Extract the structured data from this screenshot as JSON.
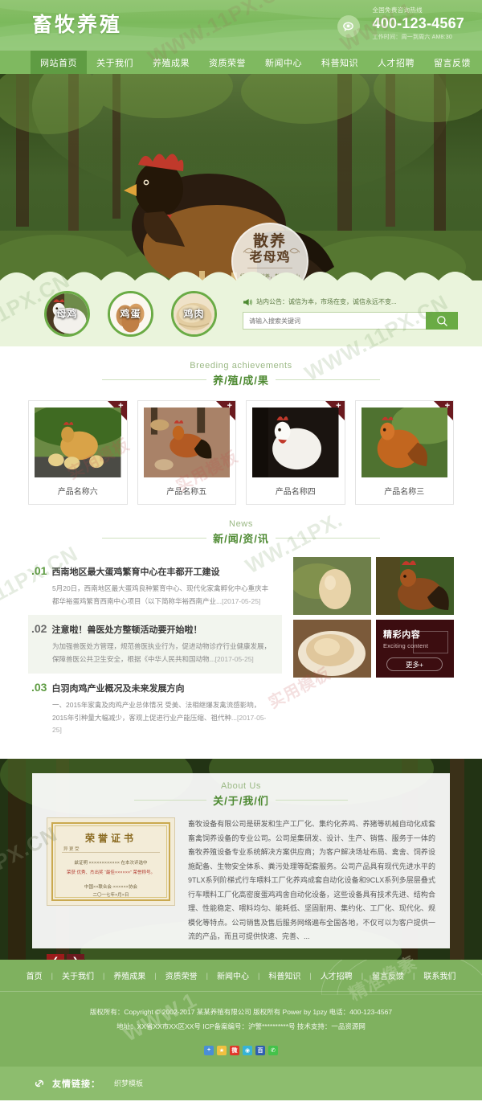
{
  "site": {
    "logo": "畜牧养殖",
    "tel_label": "全国免费咨询热线",
    "tel_number": "400-123-4567",
    "tel_time": "工作时间：周一到周六 AM8:30"
  },
  "nav": [
    {
      "label": "网站首页",
      "active": true
    },
    {
      "label": "关于我们",
      "active": false
    },
    {
      "label": "养殖成果",
      "active": false
    },
    {
      "label": "资质荣誉",
      "active": false
    },
    {
      "label": "新闻中心",
      "active": false
    },
    {
      "label": "科普知识",
      "active": false
    },
    {
      "label": "人才招聘",
      "active": false
    },
    {
      "label": "留言反馈",
      "active": false
    },
    {
      "label": "联系我们",
      "active": false
    }
  ],
  "banner": {
    "badge_line1": "散养",
    "badge_line2": "老母鸡",
    "badge_sub": "绿色食自然养，散养于青山绿林之中"
  },
  "features": [
    {
      "label": "母鸡"
    },
    {
      "label": "鸡蛋"
    },
    {
      "label": "鸡肉"
    }
  ],
  "search": {
    "notice": "站内公告：诚信为本，市场在变，诚信永远不变...",
    "placeholder": "请输入搜索关键词",
    "button_icon": "search-icon"
  },
  "achievements": {
    "heading_en": "Breeding achievements",
    "heading_cn": "养/殖/成/果",
    "corner_mark": "+",
    "items": [
      {
        "name": "产品名称六"
      },
      {
        "name": "产品名称五"
      },
      {
        "name": "产品名称四"
      },
      {
        "name": "产品名称三"
      }
    ]
  },
  "news": {
    "heading_en": "News",
    "heading_cn": "新/闻/资/讯",
    "items": [
      {
        "no": ".01",
        "title": "西南地区最大蛋鸡繁育中心在丰都开工建设",
        "desc": "5月20日，西南地区最大蛋鸡良种繁育中心、现代化家禽孵化中心重庆丰都华裕蛋鸡繁育西南中心项目（以下简称华裕西南产业...",
        "date": "[2017-05-25]"
      },
      {
        "no": ".02",
        "title": "注意啦！兽医处方整顿活动要开始啦！",
        "desc": "为加强兽医处方管理，规范兽医执业行为，促进动物诊疗行业健康发展，保障兽医公共卫生安全，根据《中华人民共和国动物...",
        "date": "[2017-05-25]"
      },
      {
        "no": ".03",
        "title": "白羽肉鸡产业概况及未来发展方向",
        "desc": "一、2015年家禽及肉鸡产业总体情况 受美、法相继爆发禽流感影响，2015年引种量大幅减少，客观上促进行业产能压缩、祖代种...",
        "date": "[2017-05-25]"
      }
    ],
    "promo": {
      "title_cn": "精彩内容",
      "title_en": "Exciting content",
      "more": "更多+"
    }
  },
  "about": {
    "heading_en": "About Us",
    "heading_cn": "关/于/我/们",
    "cert": {
      "title": "荣誉证书",
      "corner": "异 更 受",
      "line1": "兹证明 ×××××××××××× 在本次评选中",
      "line2": "荣获 优秀、杰出奖 “最佳××××××” 荣誉称号。",
      "line3": "中国××联合会·××××××协会",
      "line4": "二〇一七年×月×日"
    },
    "text": "畜牧设备有限公司是研发和生产工厂化、集约化养鸡、养猪等机械自动化成套畜禽饲养设备的专业公司。公司是集研发、设计、生产、销售、服务于一体的畜牧养殖设备专业系统解决方案供应商；为客户解决场址布局、禽舍、饲养设施配备、生物安全体系、粪污处理等配套服务。公司产品具有现代先进水平的9TLX系列阶梯式行车喂料工厂化养鸡成套自动化设备和9CLX系列多层层叠式行车喂料工厂化高密度蛋鸡鸡舍自动化设备，这些设备具有技术先进、结构合理、性能稳定、喂料均匀、能耗低、坚固耐用、集约化、工厂化、现代化、规模化等特点。公司销售及售后服务网络遍布全国各地，不仅可以为客户提供一流的产品，而且可提供快速、完善、...",
    "prev": "❮",
    "next": "❯"
  },
  "footer": {
    "nav": [
      "首页",
      "关于我们",
      "养殖成果",
      "资质荣誉",
      "新闻中心",
      "科普知识",
      "人才招聘",
      "留言反馈",
      "联系我们"
    ],
    "copyright": "版权所有：Copyright © 2002-2017 某某养殖有限公司 版权所有 Power by 1pzy   电话：400-123-4567",
    "address": "地址：XX省XX市XX区XX号    ICP备案编号：沪警**********号    技术支持：一品资源网",
    "socials": [
      "share-plus-icon",
      "favorite-star-icon",
      "sina-weibo-icon",
      "qzone-icon",
      "baidu-icon",
      "wechat-icon"
    ],
    "links_title": "友情链接：",
    "links": [
      "织梦模板"
    ],
    "links_icon": "link-chain-icon"
  },
  "colors": {
    "brand_green": "#7fb960",
    "dark_green": "#5f9c43",
    "heading_green": "#4e8a32",
    "dark_red": "#6b1a1f",
    "panel_bg": "#eaf4dc"
  }
}
